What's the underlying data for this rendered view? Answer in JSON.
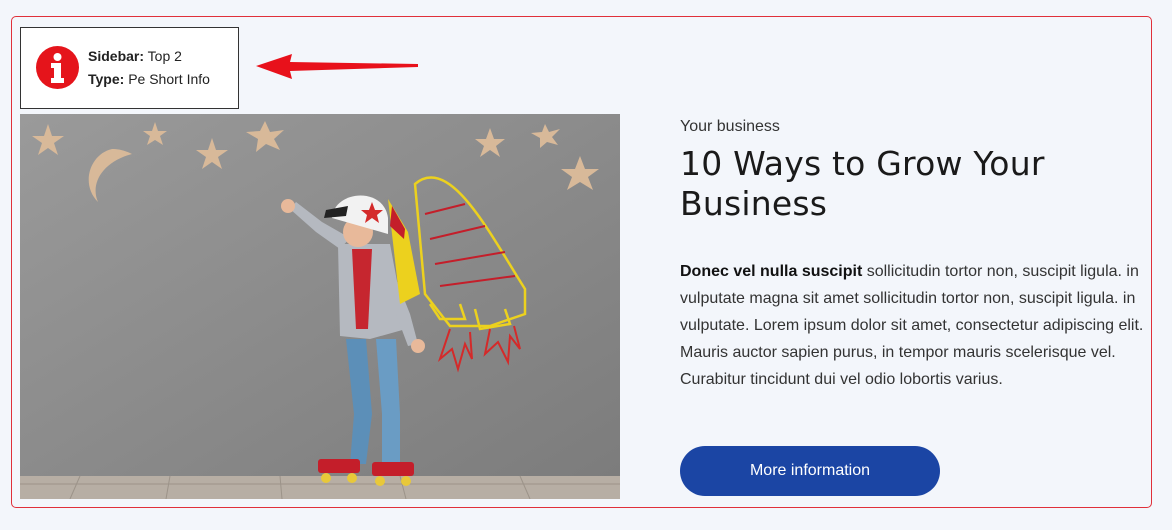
{
  "info_box": {
    "sidebar_label": "Sidebar:",
    "sidebar_value": "Top 2",
    "type_label": "Type:",
    "type_value": "Pe Short Info",
    "icon": "info-icon",
    "icon_color": "#e5141b"
  },
  "annotation": {
    "arrow_icon": "arrow-left-icon",
    "arrow_color": "#e8111b"
  },
  "hero_image": {
    "description_icon": "kid-rocket-illustration",
    "background_color": "#8d8d8d"
  },
  "content": {
    "eyebrow": "Your business",
    "title": "10 Ways to Grow Your Business",
    "body_bold": "Donec vel nulla suscipit",
    "body_rest": " sollicitudin tortor non, suscipit ligula. in vulputate magna sit amet sollicitudin tortor non, suscipit ligula. in vulputate. Lorem ipsum dolor sit amet, consectetur adipiscing elit. Mauris auctor sapien purus, in tempor mauris scelerisque vel. Curabitur tincidunt dui vel odio lobortis varius.",
    "button_label": "More information"
  },
  "colors": {
    "frame_border": "#e0303a",
    "page_bg": "#f3f6fb",
    "button_bg": "#1b45a4"
  }
}
